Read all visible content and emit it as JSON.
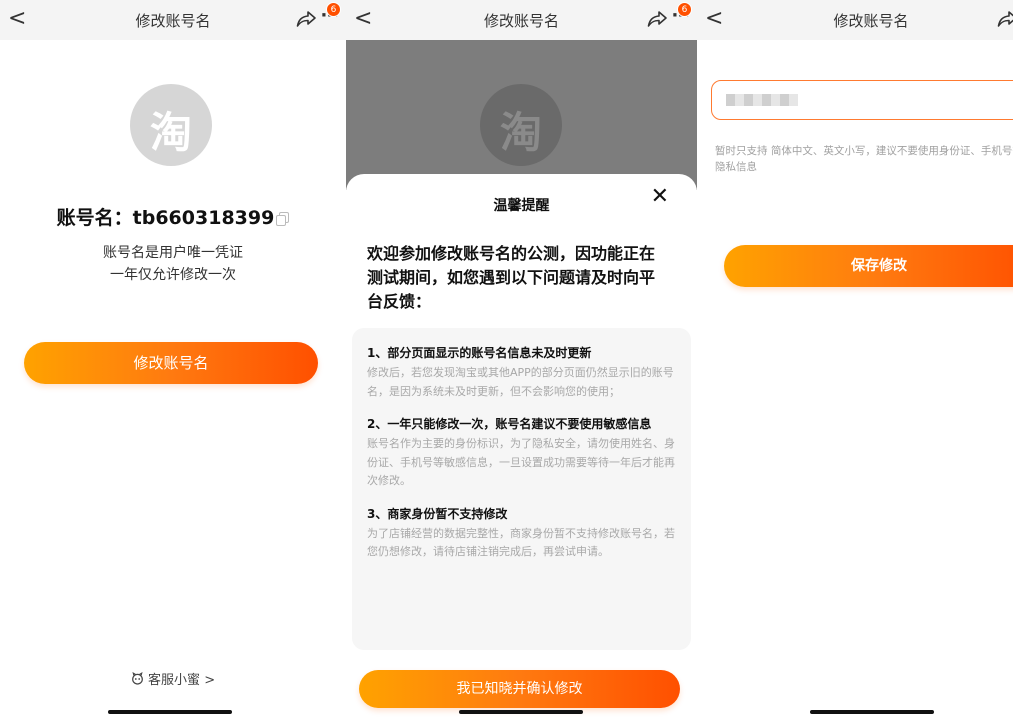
{
  "screens": [
    {
      "nav": {
        "back": "<",
        "title": "修改账号名",
        "more": "···",
        "badge": "6"
      },
      "logo_char": "淘",
      "account_label": "账号名：tb660318399",
      "desc_line1": "账号名是用户唯一凭证",
      "desc_line2": "一年仅允许修改一次",
      "modify_button": "修改账号名",
      "service_link": "客服小蜜",
      "service_chevron": ">"
    },
    {
      "nav": {
        "back": "<",
        "title": "修改账号名",
        "more": "···",
        "badge": "6"
      },
      "logo_char": "淘",
      "sheet": {
        "title": "温馨提醒",
        "close": "✕",
        "intro": "欢迎参加修改账号名的公测，因功能正在测试期间，如您遇到以下问题请及时向平台反馈：",
        "items": [
          {
            "heading": "1、部分页面显示的账号名信息未及时更新",
            "body": "修改后，若您发现淘宝或其他APP的部分页面仍然显示旧的账号名，是因为系统未及时更新，但不会影响您的使用；"
          },
          {
            "heading": "2、一年只能修改一次，账号名建议不要使用敏感信息",
            "body": "账号名作为主要的身份标识，为了隐私安全，请勿使用姓名、身份证、手机号等敏感信息，一旦设置成功需要等待一年后才能再次修改。"
          },
          {
            "heading": "3、商家身份暂不支持修改",
            "body": "为了店铺经营的数据完整性，商家身份暂不支持修改账号名，若您仍想修改，请待店铺注销完成后，再尝试申请。"
          }
        ],
        "confirm_button": "我已知晓并确认修改"
      }
    },
    {
      "nav": {
        "back": "<",
        "title": "修改账号名"
      },
      "hint": "暂时只支持 简体中文、英文小写，建议不要使用身份证、手机号等隐私信息",
      "save_button": "保存修改"
    }
  ],
  "colors": {
    "accent": "#ff5000",
    "accent_light": "#ffa200",
    "badge": "#ff5000"
  }
}
